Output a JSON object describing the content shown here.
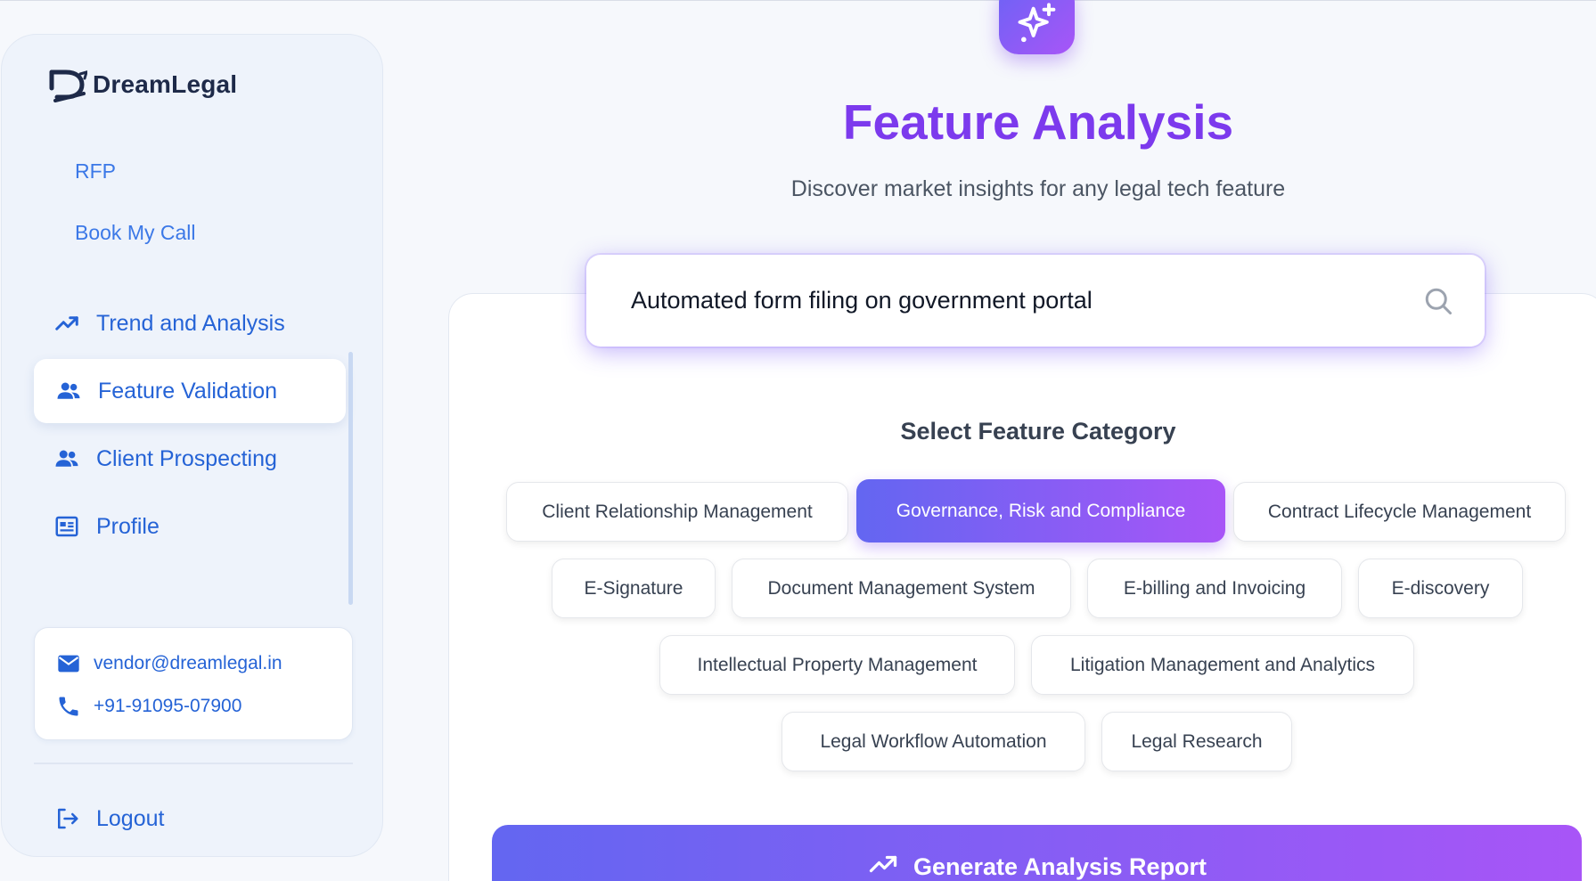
{
  "brand": {
    "name": "DreamLegal"
  },
  "sidebar": {
    "plain_links": [
      {
        "label": "RFP"
      },
      {
        "label": "Book My Call"
      }
    ],
    "items": [
      {
        "label": "Trend and Analysis",
        "icon": "trending-up-icon"
      },
      {
        "label": "Feature Validation",
        "icon": "users-icon",
        "active": true
      },
      {
        "label": "Client Prospecting",
        "icon": "users-icon"
      },
      {
        "label": "Profile",
        "icon": "id-card-icon"
      }
    ],
    "contact": {
      "email": "vendor@dreamlegal.in",
      "phone": "+91-91095-07900"
    },
    "logout_label": "Logout"
  },
  "main": {
    "title": "Feature Analysis",
    "subtitle": "Discover market insights for any legal tech feature",
    "search": {
      "value": "Automated form filing on government portal"
    },
    "category_title": "Select Feature Category",
    "categories": [
      {
        "label": "Client Relationship Management"
      },
      {
        "label": "Governance, Risk and Compliance",
        "selected": true
      },
      {
        "label": "Contract Lifecycle Management"
      },
      {
        "label": "E-Signature"
      },
      {
        "label": "Document Management System"
      },
      {
        "label": "E-billing and Invoicing"
      },
      {
        "label": "E-discovery"
      },
      {
        "label": "Intellectual Property Management"
      },
      {
        "label": "Litigation Management and Analytics"
      },
      {
        "label": "Legal Workflow Automation"
      },
      {
        "label": "Legal Research"
      }
    ],
    "generate_label": "Generate Analysis Report"
  },
  "colors": {
    "accent": "#2563d6",
    "title_purple": "#7c3aed",
    "gradient_start": "#6366f1",
    "gradient_end": "#a855f7"
  }
}
